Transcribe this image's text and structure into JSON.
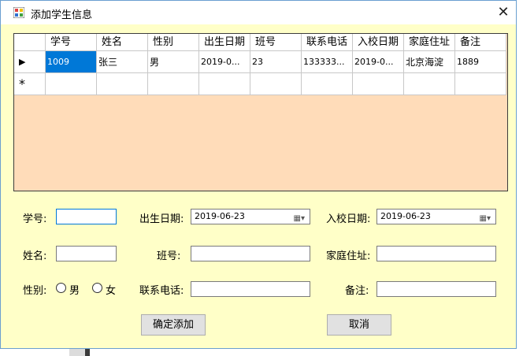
{
  "window": {
    "title": "添加学生信息",
    "close_glyph": "✕"
  },
  "grid": {
    "columns": [
      "学号",
      "姓名",
      "性别",
      "出生日期",
      "班号",
      "联系电话",
      "入校日期",
      "家庭住址",
      "备注"
    ],
    "row_indicator": "▶",
    "new_row_indicator": "*",
    "rows": [
      [
        "1009",
        "张三",
        "男",
        "2019-0...",
        "23",
        "133333...",
        "2019-0...",
        "北京海淀",
        "1889"
      ]
    ]
  },
  "form": {
    "student_id_label": "学号:",
    "student_id_value": "",
    "birth_date_label": "出生日期:",
    "birth_date_value": "2019-06-23",
    "enroll_date_label": "入校日期:",
    "enroll_date_value": "2019-06-23",
    "name_label": "姓名:",
    "name_value": "",
    "class_label": "班号:",
    "class_value": "",
    "address_label": "家庭住址:",
    "address_value": "",
    "gender_label": "性别:",
    "gender_male": "男",
    "gender_female": "女",
    "phone_label": "联系电话:",
    "phone_value": "",
    "remark_label": "备注:",
    "remark_value": ""
  },
  "buttons": {
    "confirm": "确定添加",
    "cancel": "取消"
  },
  "icons": {
    "app": "app-icon",
    "calendar": "calendar-icon",
    "dropdown": "chevron-down-icon"
  }
}
